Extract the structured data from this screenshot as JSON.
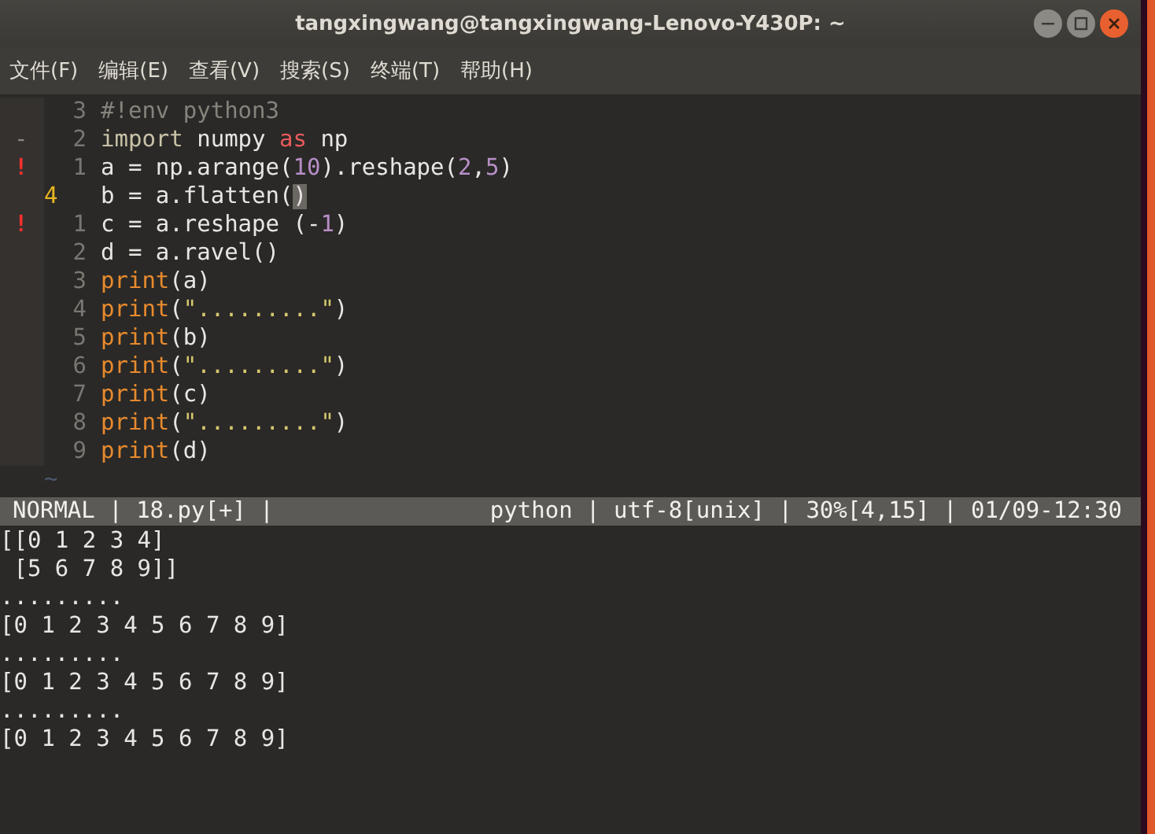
{
  "window": {
    "title": "tangxingwang@tangxingwang-Lenovo-Y430P: ~"
  },
  "menu": [
    "文件(F)",
    "编辑(E)",
    "查看(V)",
    "搜索(S)",
    "终端(T)",
    "帮助(H)"
  ],
  "editor": {
    "lines": [
      {
        "number": "3",
        "current": false,
        "tokens": [
          {
            "text": "#!env python3",
            "kind": "comment"
          }
        ]
      },
      {
        "sign": "-",
        "number": "2",
        "current": false,
        "tokens": [
          {
            "text": "import",
            "kind": "keyword"
          },
          {
            "text": " numpy ",
            "kind": "plain"
          },
          {
            "text": "as",
            "kind": "operator"
          },
          {
            "text": " np",
            "kind": "plain"
          }
        ]
      },
      {
        "sign": "!",
        "number": "1",
        "current": false,
        "tokens": [
          {
            "text": "a = np.arange(",
            "kind": "plain"
          },
          {
            "text": "10",
            "kind": "number"
          },
          {
            "text": ").reshape(",
            "kind": "plain"
          },
          {
            "text": "2",
            "kind": "number"
          },
          {
            "text": ",",
            "kind": "plain"
          },
          {
            "text": "5",
            "kind": "number"
          },
          {
            "text": ")",
            "kind": "plain"
          }
        ]
      },
      {
        "number": "4",
        "current": true,
        "tokens": [
          {
            "text": "b = a.flatten(",
            "kind": "plain"
          },
          {
            "text": ")",
            "kind": "cursor"
          }
        ]
      },
      {
        "sign": "!",
        "number": "1",
        "current": false,
        "tokens": [
          {
            "text": "c = a.reshape (-",
            "kind": "plain"
          },
          {
            "text": "1",
            "kind": "number"
          },
          {
            "text": ")",
            "kind": "plain"
          }
        ]
      },
      {
        "number": "2",
        "current": false,
        "tokens": [
          {
            "text": "d = a.ravel()",
            "kind": "plain"
          }
        ]
      },
      {
        "number": "3",
        "current": false,
        "tokens": [
          {
            "text": "print",
            "kind": "function"
          },
          {
            "text": "(a)",
            "kind": "plain"
          }
        ]
      },
      {
        "number": "4",
        "current": false,
        "tokens": [
          {
            "text": "print",
            "kind": "function"
          },
          {
            "text": "(",
            "kind": "plain"
          },
          {
            "text": "\".........\"",
            "kind": "string"
          },
          {
            "text": ")",
            "kind": "plain"
          }
        ]
      },
      {
        "number": "5",
        "current": false,
        "tokens": [
          {
            "text": "print",
            "kind": "function"
          },
          {
            "text": "(b)",
            "kind": "plain"
          }
        ]
      },
      {
        "number": "6",
        "current": false,
        "tokens": [
          {
            "text": "print",
            "kind": "function"
          },
          {
            "text": "(",
            "kind": "plain"
          },
          {
            "text": "\".........\"",
            "kind": "string"
          },
          {
            "text": ")",
            "kind": "plain"
          }
        ]
      },
      {
        "number": "7",
        "current": false,
        "tokens": [
          {
            "text": "print",
            "kind": "function"
          },
          {
            "text": "(c)",
            "kind": "plain"
          }
        ]
      },
      {
        "number": "8",
        "current": false,
        "tokens": [
          {
            "text": "print",
            "kind": "function"
          },
          {
            "text": "(",
            "kind": "plain"
          },
          {
            "text": "\".........\"",
            "kind": "string"
          },
          {
            "text": ")",
            "kind": "plain"
          }
        ]
      },
      {
        "number": "9",
        "current": false,
        "tokens": [
          {
            "text": "print",
            "kind": "function"
          },
          {
            "text": "(d)",
            "kind": "plain"
          }
        ]
      }
    ],
    "filler": "~"
  },
  "status_bar": {
    "left": "NORMAL | 18.py[+] |",
    "right": "python | utf-8[unix] | 30%[4,15] | 01/09-12:30"
  },
  "output": [
    "[[0 1 2 3 4]",
    " [5 6 7 8 9]]",
    ".........",
    "[0 1 2 3 4 5 6 7 8 9]",
    ".........",
    "[0 1 2 3 4 5 6 7 8 9]",
    ".........",
    "[0 1 2 3 4 5 6 7 8 9]"
  ]
}
